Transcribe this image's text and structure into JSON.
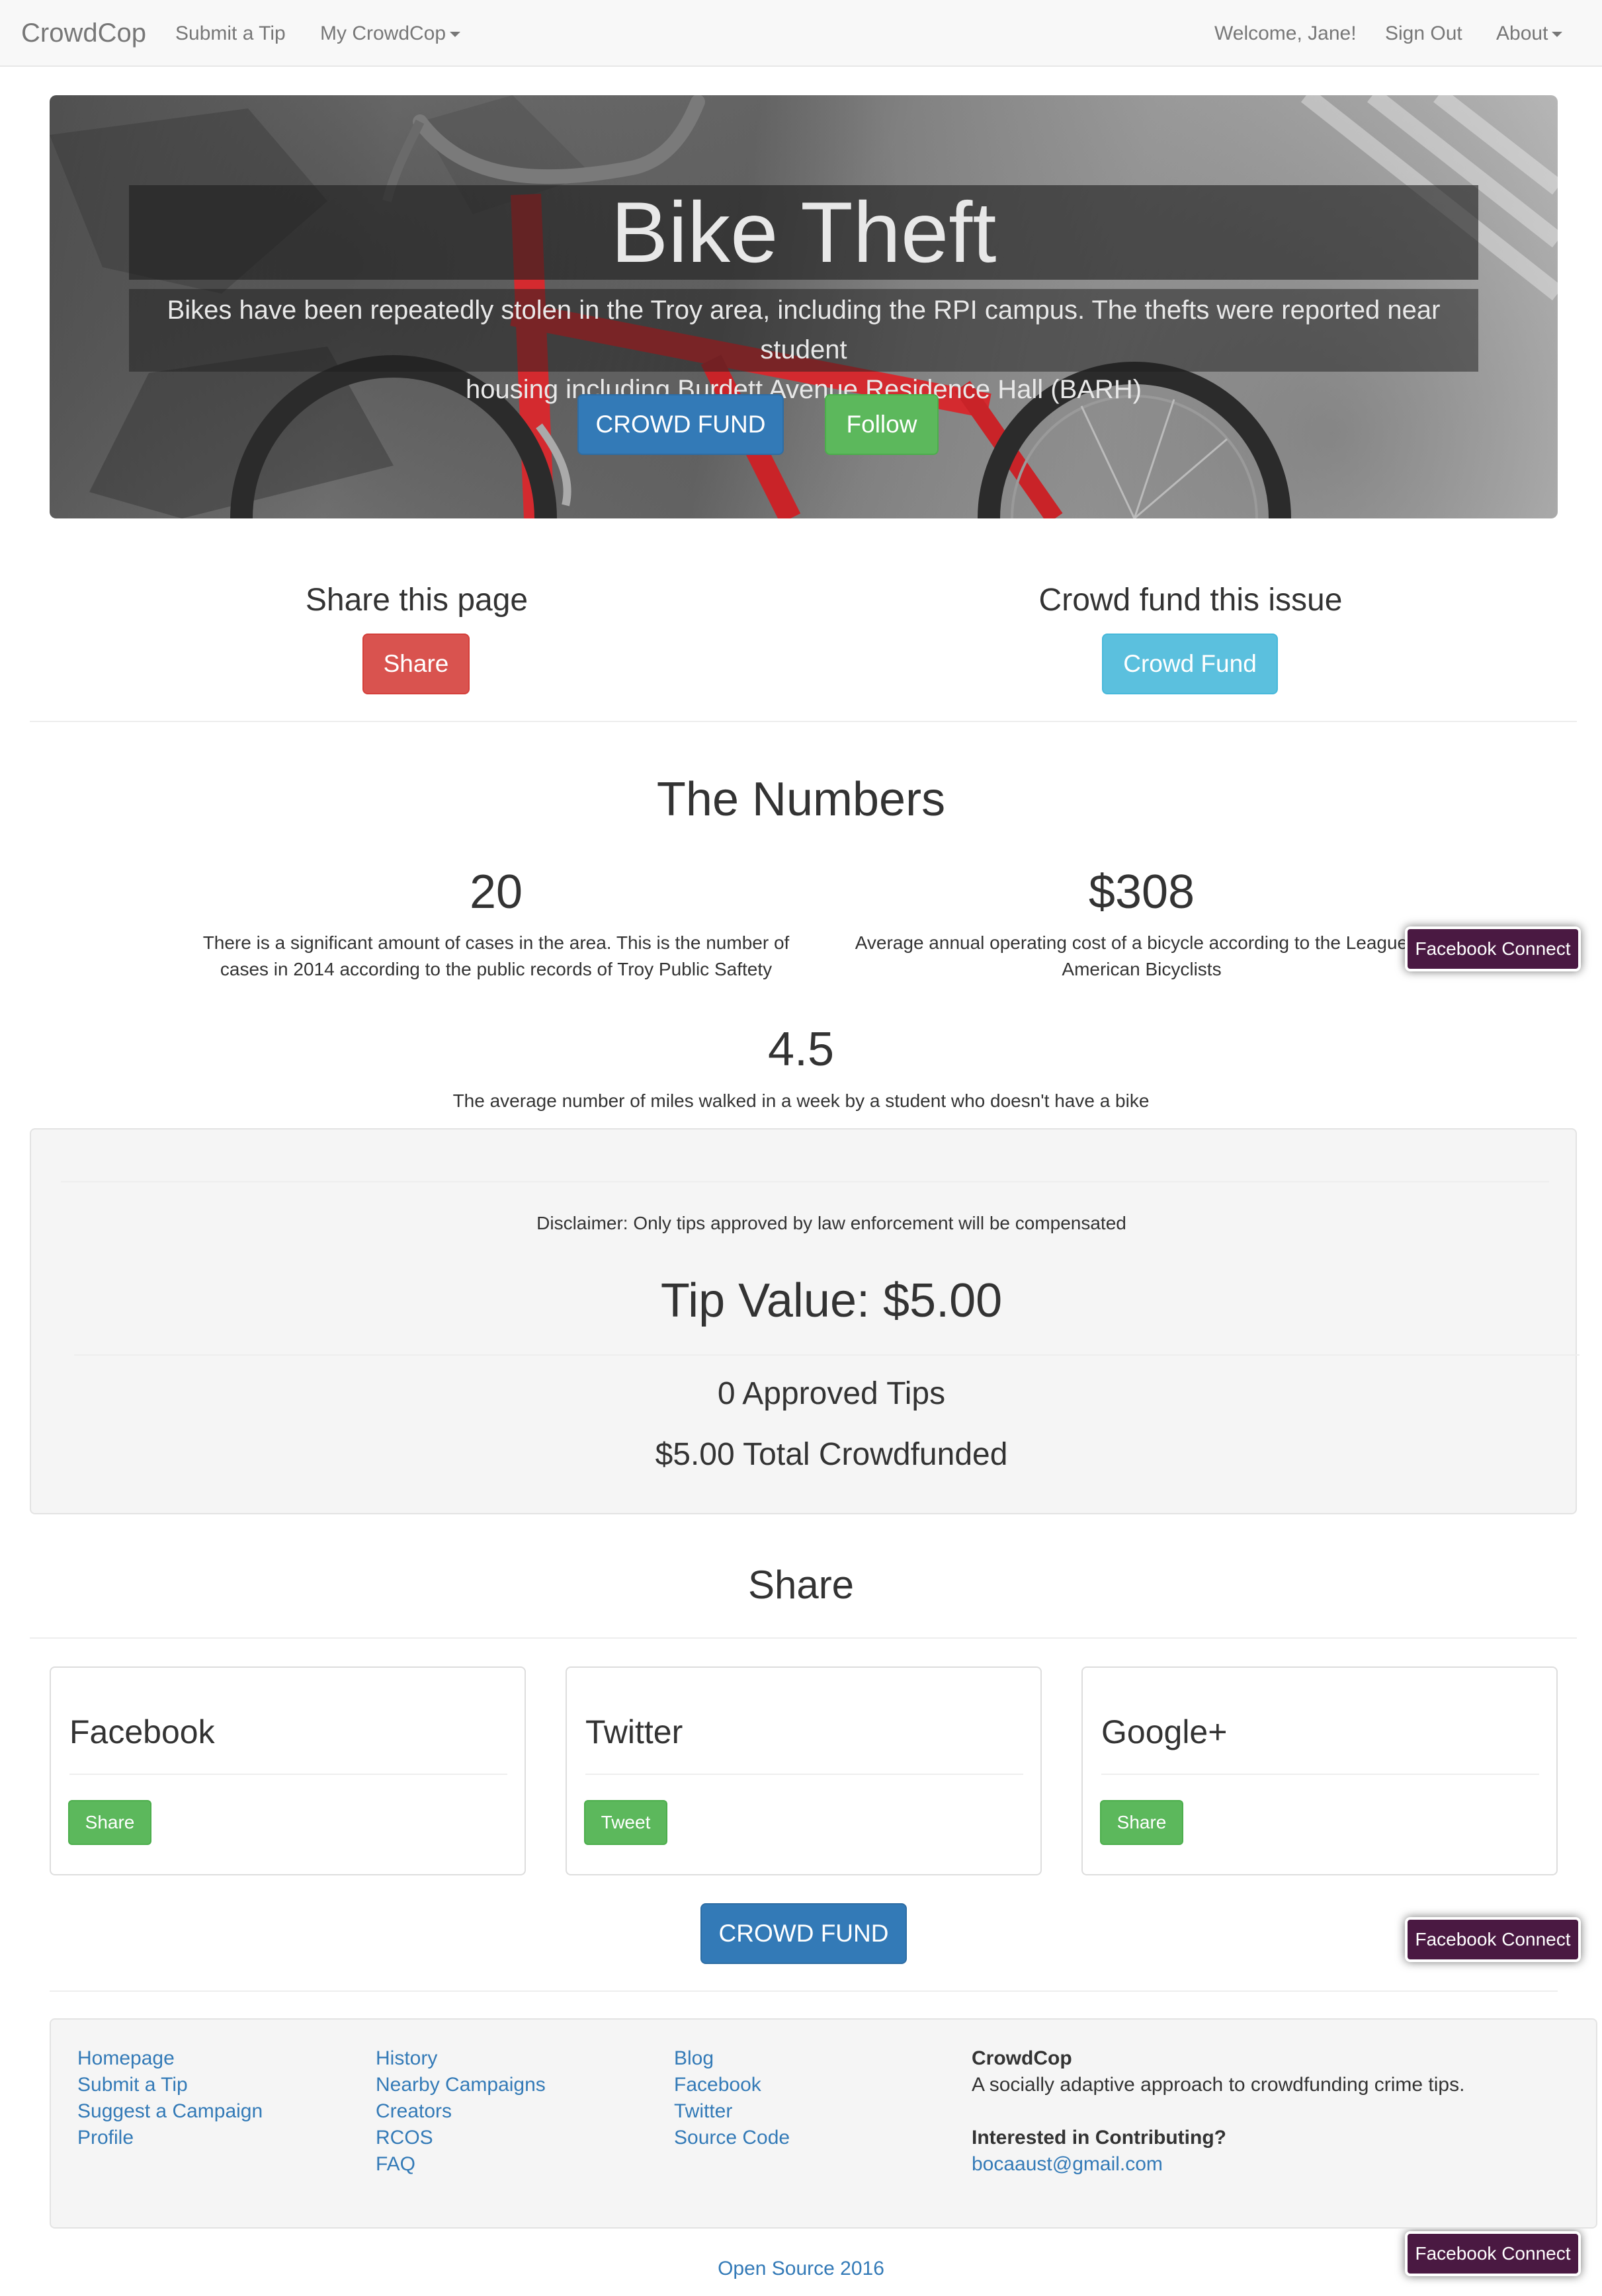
{
  "navbar": {
    "brand": "CrowdCop",
    "submit_tip": "Submit a Tip",
    "my_crowdcop": "My CrowdCop",
    "welcome": "Welcome, Jane!",
    "sign_out": "Sign Out",
    "about": "About"
  },
  "hero": {
    "title": "Bike Theft",
    "description_line1": "Bikes have been repeatedly stolen in the Troy area, including the RPI campus. The thefts were reported near student",
    "description_line2": "housing including Burdett Avenue Residence Hall (BARH)",
    "crowd_fund_button": "CROWD FUND",
    "follow_button": "Follow"
  },
  "share_section": {
    "share_heading": "Share this page",
    "share_button": "Share",
    "crowd_heading": "Crowd fund this issue",
    "crowd_button": "Crowd Fund"
  },
  "numbers": {
    "heading": "The Numbers",
    "items": [
      {
        "value": "20",
        "line1": "There is a significant amount of cases in the area. This is the number of",
        "line2": "cases in 2014 according to the public records of Troy Public Saftety"
      },
      {
        "value": "$308",
        "line1": "Average annual operating cost of a bicycle according to the League of",
        "line2": "American Bicyclists"
      },
      {
        "value": "4.5",
        "line1": "The average number of miles walked in a week by a student who doesn't have a bike"
      }
    ]
  },
  "tip": {
    "disclaimer": "Disclaimer: Only tips approved by law enforcement will be compensated",
    "tip_value": "Tip Value: $5.00",
    "approved_tips": "0 Approved Tips",
    "total_crowdfunded": "$5.00 Total Crowdfunded"
  },
  "social": {
    "heading": "Share",
    "panels": [
      {
        "title": "Facebook",
        "button": "Share"
      },
      {
        "title": "Twitter",
        "button": "Tweet"
      },
      {
        "title": "Google+",
        "button": "Share"
      }
    ],
    "crowd_fund_button": "CROWD FUND"
  },
  "facebook_connect": "Facebook Connect",
  "footer": {
    "col1": [
      "Homepage",
      "Submit a Tip",
      "Suggest a Campaign",
      "Profile"
    ],
    "col2": [
      "History",
      "Nearby Campaigns",
      "Creators",
      "RCOS",
      "FAQ"
    ],
    "col3": [
      "Blog",
      "Facebook",
      "Twitter",
      "Source Code"
    ],
    "about_title": "CrowdCop",
    "about_text": "A socially adaptive approach to crowdfunding crime tips.",
    "contrib_title": "Interested in Contributing?",
    "contrib_email": "bocaaust@gmail.com",
    "bottom_link": "Open Source 2016"
  },
  "colors": {
    "primary": "#337ab7",
    "success": "#5cb85c",
    "danger": "#d9534f",
    "info": "#5bc0de",
    "facebook_connect": "#4a1942"
  }
}
